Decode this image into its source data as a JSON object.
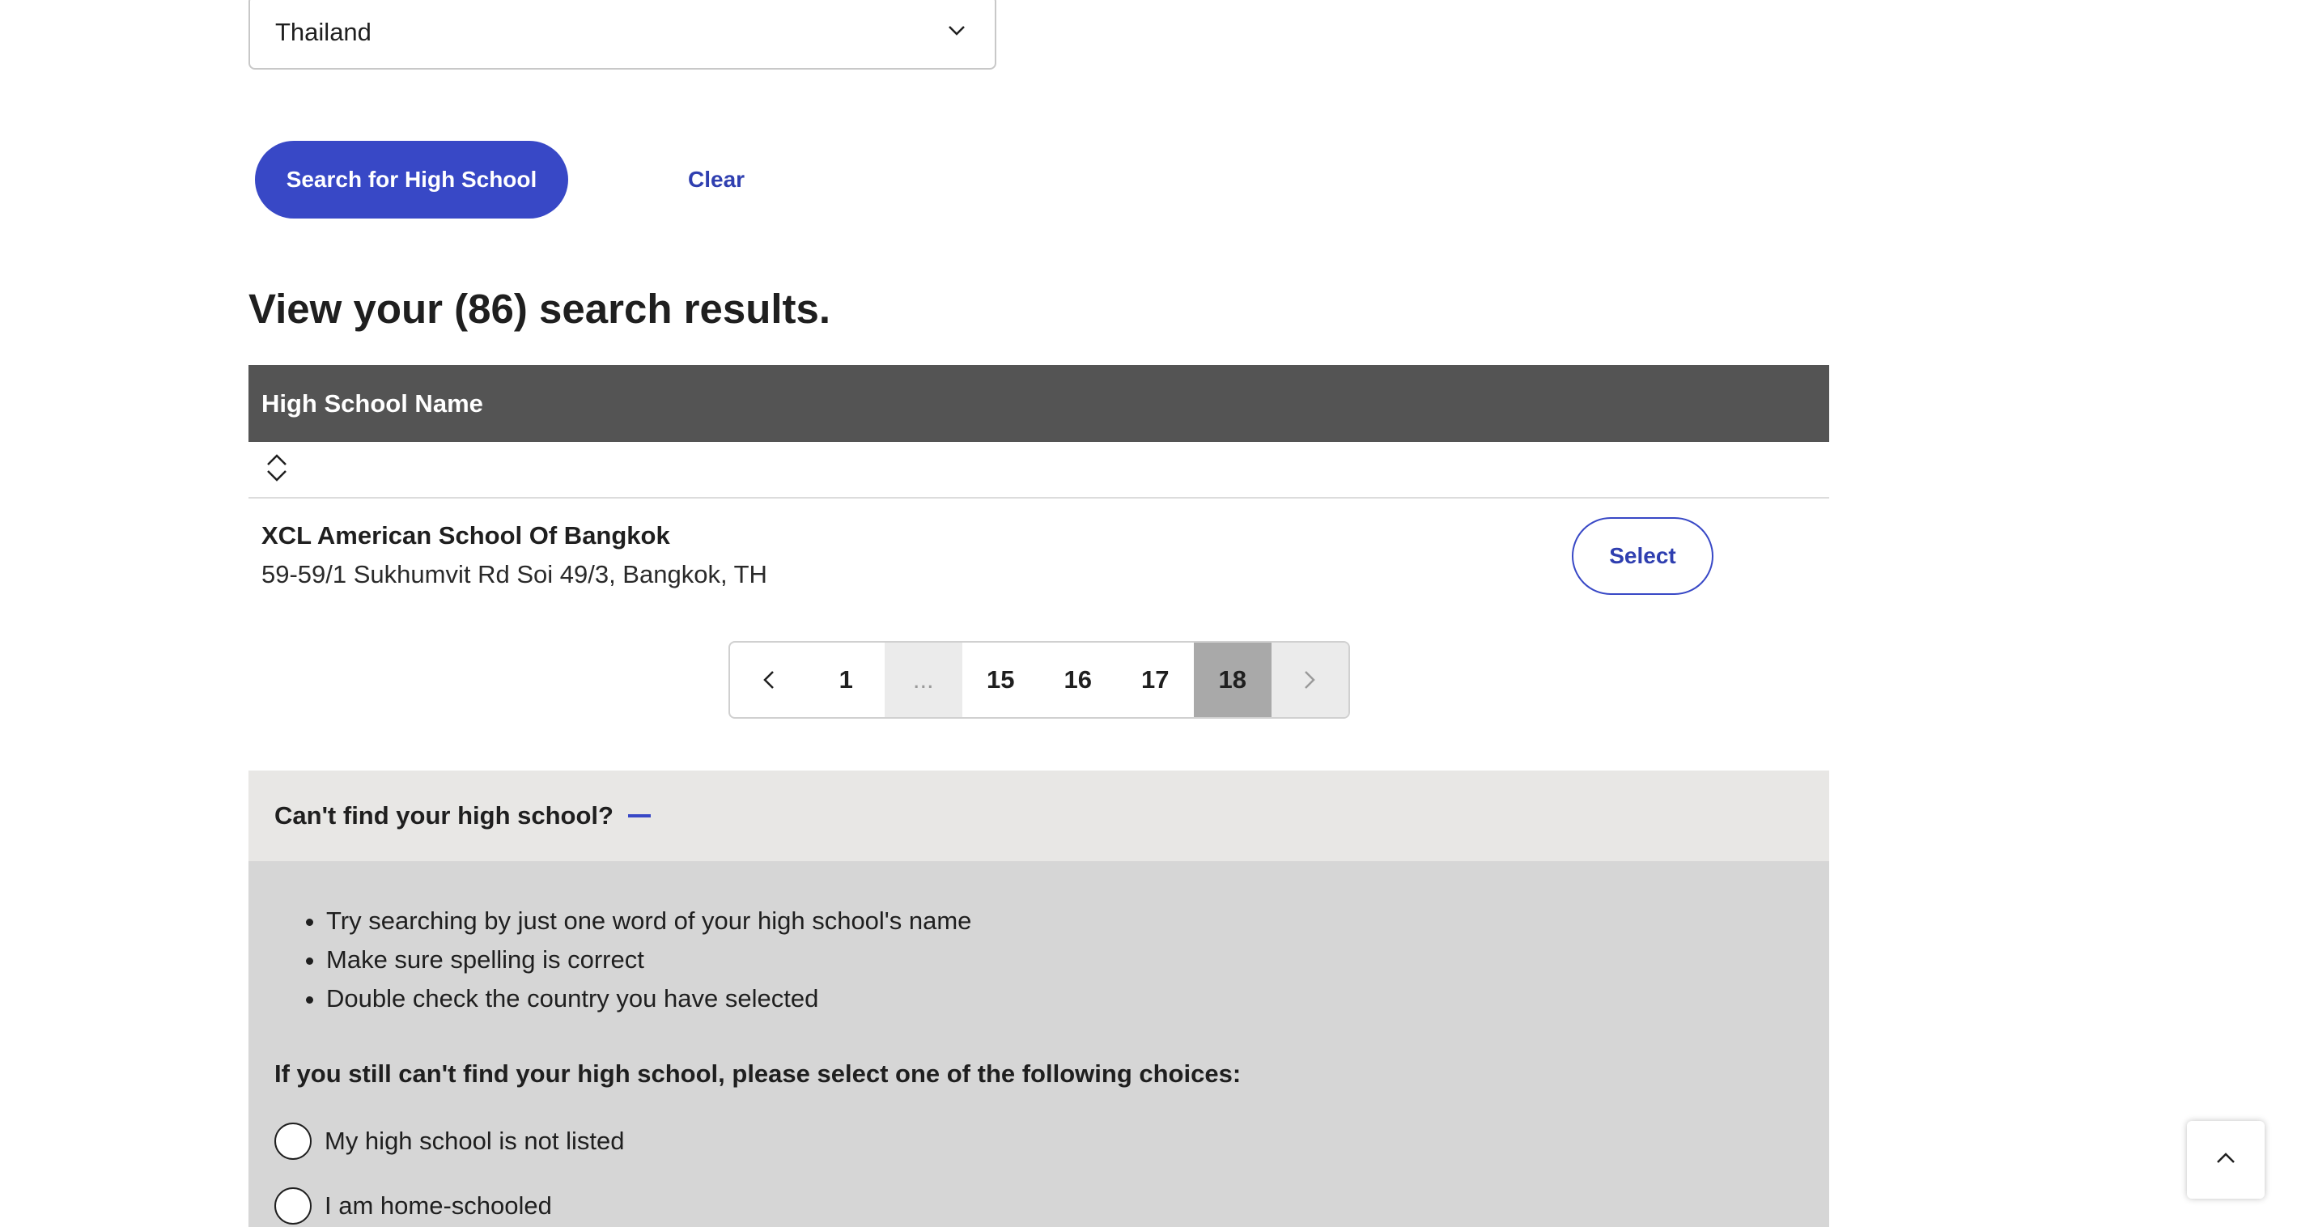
{
  "country_select": {
    "value": "Thailand",
    "icon": "chevron-down-icon"
  },
  "buttons": {
    "search": "Search for High School",
    "clear": "Clear"
  },
  "results": {
    "heading": "View your (86) search results.",
    "column_header": "High School Name",
    "sort_icon": "sort-icon",
    "rows": [
      {
        "name": "XCL American School Of Bangkok",
        "address": "59-59/1 Sukhumvit Rd Soi 49/3, Bangkok, TH",
        "action": "Select"
      }
    ]
  },
  "pagination": {
    "pages": [
      "1",
      "...",
      "15",
      "16",
      "17",
      "18"
    ],
    "current": "18",
    "prev_icon": "chevron-left-icon",
    "next_icon": "chevron-right-icon"
  },
  "help": {
    "title": "Can't find your high school?",
    "toggle_icon": "collapse-icon",
    "tips": [
      "Try searching by just one word of your high school's name",
      "Make sure spelling is correct",
      "Double check the country you have selected"
    ],
    "choices_label": "If you still can't find your high school, please select one of the following choices:",
    "choices": [
      "My high school is not listed",
      "I am home-schooled"
    ]
  },
  "back_to_top_icon": "chevron-up-icon",
  "colors": {
    "primary": "#3848c6",
    "table_header_bg": "#545454",
    "help_header_bg": "#e8e7e5",
    "help_body_bg": "#d6d6d6",
    "current_page_bg": "#a9a9a9"
  }
}
